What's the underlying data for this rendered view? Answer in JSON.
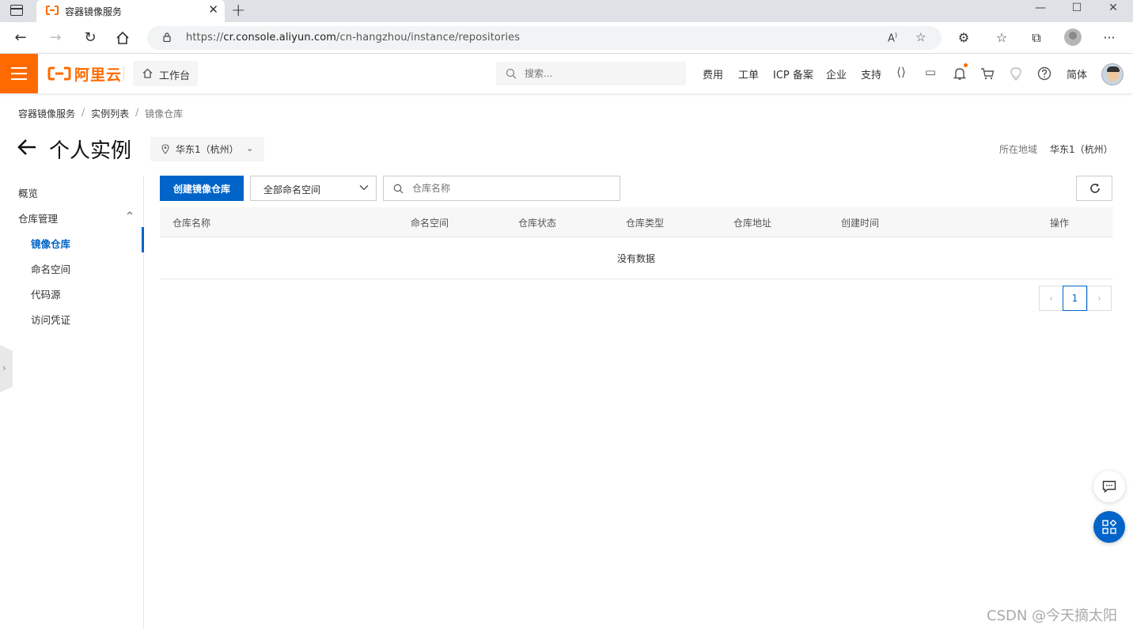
{
  "browser": {
    "tab_title": "容器镜像服务",
    "url_scheme": "https://",
    "url_host": "cr.console.aliyun.com",
    "url_path": "/cn-hangzhou/instance/repositories"
  },
  "topnav": {
    "logo_text": "阿里云",
    "workbench_label": "工作台",
    "search_placeholder": "搜索...",
    "links": [
      "费用",
      "工单",
      "ICP 备案",
      "企业",
      "支持"
    ],
    "lang_label": "简体",
    "brand_color": "#ff6a00"
  },
  "breadcrumb": {
    "items": [
      "容器镜像服务",
      "实例列表",
      "镜像仓库"
    ],
    "separator": "/"
  },
  "header": {
    "title": "个人实例",
    "region_select_value": "华东1（杭州）",
    "region_info_label": "所在地域",
    "region_info_value": "华东1（杭州）"
  },
  "side_menu": {
    "overview": "概览",
    "repo_mgmt": "仓库管理",
    "items": [
      "镜像仓库",
      "命名空间",
      "代码源",
      "访问凭证"
    ],
    "active_color": "#0064c8"
  },
  "toolbar": {
    "create_label": "创建镜像仓库",
    "namespace_select_value": "全部命名空间",
    "repo_search_placeholder": "仓库名称"
  },
  "table": {
    "columns": [
      "仓库名称",
      "命名空间",
      "仓库状态",
      "仓库类型",
      "仓库地址",
      "创建时间",
      "操作"
    ],
    "empty_text": "没有数据"
  },
  "pagination": {
    "current_page": "1",
    "prev_icon": "chevron-left",
    "next_icon": "chevron-right"
  },
  "watermark": "CSDN @今天摘太阳"
}
